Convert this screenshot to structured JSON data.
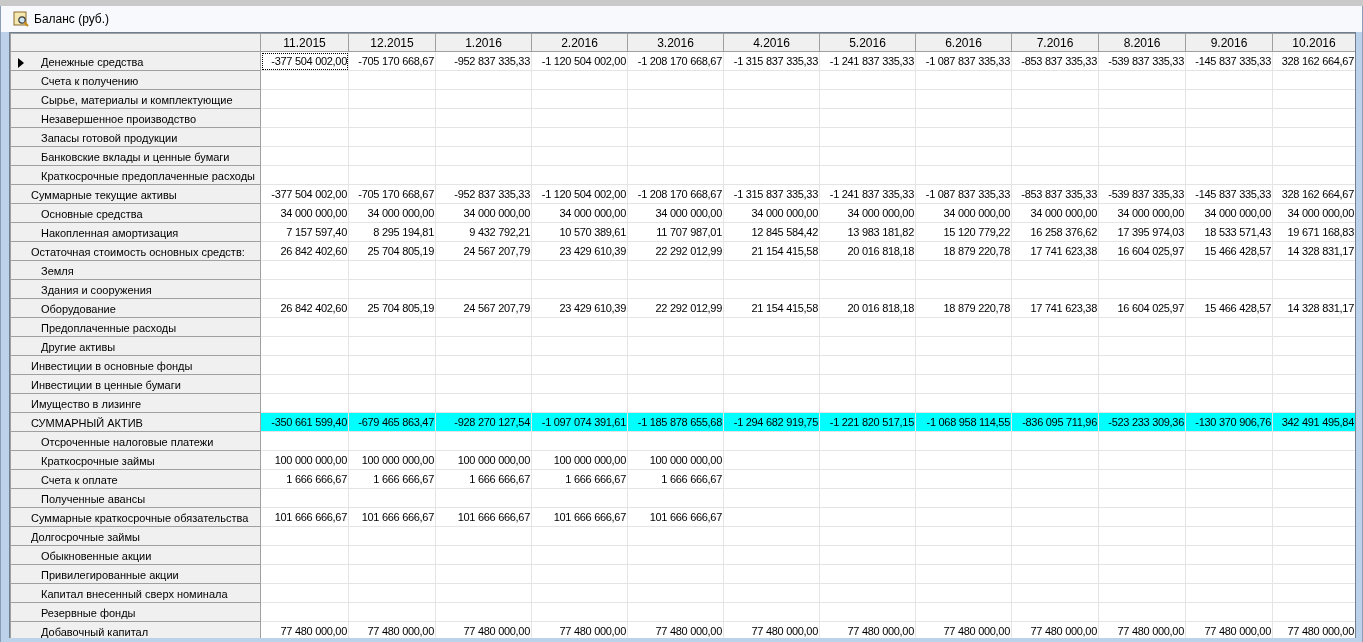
{
  "window": {
    "title": "Баланс (руб.)"
  },
  "table": {
    "columns": [
      "11.2015",
      "12.2015",
      "1.2016",
      "2.2016",
      "3.2016",
      "4.2016",
      "5.2016",
      "6.2016",
      "7.2016",
      "8.2016",
      "9.2016",
      "10.2016"
    ],
    "rows": [
      {
        "label": "Денежные средства",
        "kind": "detail",
        "current": true,
        "highlighted": false,
        "values": [
          "-377 504 002,00",
          "-705 170 668,67",
          "-952 837 335,33",
          "-1 120 504 002,00",
          "-1 208 170 668,67",
          "-1 315 837 335,33",
          "-1 241 837 335,33",
          "-1 087 837 335,33",
          "-853 837 335,33",
          "-539 837 335,33",
          "-145 837 335,33",
          "328 162 664,67"
        ]
      },
      {
        "label": "Счета к получению",
        "kind": "detail",
        "current": false,
        "highlighted": false
      },
      {
        "label": "Сырье, материалы и комплектующие",
        "kind": "detail",
        "current": false,
        "highlighted": false
      },
      {
        "label": "Незавершенное производство",
        "kind": "detail",
        "current": false,
        "highlighted": false
      },
      {
        "label": "Запасы готовой продукции",
        "kind": "detail",
        "current": false,
        "highlighted": false
      },
      {
        "label": "Банковские вклады и ценные бумаги",
        "kind": "detail",
        "current": false,
        "highlighted": false
      },
      {
        "label": "Краткосрочные предоплаченные расходы",
        "kind": "detail",
        "current": false,
        "highlighted": false
      },
      {
        "label": "Суммарные текущие активы",
        "kind": "total",
        "current": false,
        "highlighted": false,
        "values": [
          "-377 504 002,00",
          "-705 170 668,67",
          "-952 837 335,33",
          "-1 120 504 002,00",
          "-1 208 170 668,67",
          "-1 315 837 335,33",
          "-1 241 837 335,33",
          "-1 087 837 335,33",
          "-853 837 335,33",
          "-539 837 335,33",
          "-145 837 335,33",
          "328 162 664,67"
        ]
      },
      {
        "label": "Основные средства",
        "kind": "detail",
        "current": false,
        "highlighted": false,
        "values": [
          "34 000 000,00",
          "34 000 000,00",
          "34 000 000,00",
          "34 000 000,00",
          "34 000 000,00",
          "34 000 000,00",
          "34 000 000,00",
          "34 000 000,00",
          "34 000 000,00",
          "34 000 000,00",
          "34 000 000,00",
          "34 000 000,00"
        ]
      },
      {
        "label": "Накопленная амортизация",
        "kind": "detail",
        "current": false,
        "highlighted": false,
        "values": [
          "7 157 597,40",
          "8 295 194,81",
          "9 432 792,21",
          "10 570 389,61",
          "11 707 987,01",
          "12 845 584,42",
          "13 983 181,82",
          "15 120 779,22",
          "16 258 376,62",
          "17 395 974,03",
          "18 533 571,43",
          "19 671 168,83"
        ]
      },
      {
        "label": "Остаточная стоимость основных средств:",
        "kind": "total",
        "current": false,
        "highlighted": false,
        "values": [
          "26 842 402,60",
          "25 704 805,19",
          "24 567 207,79",
          "23 429 610,39",
          "22 292 012,99",
          "21 154 415,58",
          "20 016 818,18",
          "18 879 220,78",
          "17 741 623,38",
          "16 604 025,97",
          "15 466 428,57",
          "14 328 831,17"
        ]
      },
      {
        "label": "Земля",
        "kind": "detail",
        "current": false,
        "highlighted": false
      },
      {
        "label": "Здания и сооружения",
        "kind": "detail",
        "current": false,
        "highlighted": false
      },
      {
        "label": "Оборудование",
        "kind": "detail",
        "current": false,
        "highlighted": false,
        "values": [
          "26 842 402,60",
          "25 704 805,19",
          "24 567 207,79",
          "23 429 610,39",
          "22 292 012,99",
          "21 154 415,58",
          "20 016 818,18",
          "18 879 220,78",
          "17 741 623,38",
          "16 604 025,97",
          "15 466 428,57",
          "14 328 831,17"
        ]
      },
      {
        "label": "Предоплаченные расходы",
        "kind": "detail",
        "current": false,
        "highlighted": false
      },
      {
        "label": "Другие активы",
        "kind": "detail",
        "current": false,
        "highlighted": false
      },
      {
        "label": "Инвестиции в основные фонды",
        "kind": "total",
        "current": false,
        "highlighted": false
      },
      {
        "label": "Инвестиции в ценные бумаги",
        "kind": "total",
        "current": false,
        "highlighted": false
      },
      {
        "label": "Имущество в лизинге",
        "kind": "total",
        "current": false,
        "highlighted": false
      },
      {
        "label": "СУММАРНЫЙ АКТИВ",
        "kind": "total",
        "current": false,
        "highlighted": true,
        "values": [
          "-350 661 599,40",
          "-679 465 863,47",
          "-928 270 127,54",
          "-1 097 074 391,61",
          "-1 185 878 655,68",
          "-1 294 682 919,75",
          "-1 221 820 517,15",
          "-1 068 958 114,55",
          "-836 095 711,96",
          "-523 233 309,36",
          "-130 370 906,76",
          "342 491 495,84"
        ]
      },
      {
        "label": "Отсроченные налоговые платежи",
        "kind": "detail",
        "current": false,
        "highlighted": false
      },
      {
        "label": "Краткосрочные займы",
        "kind": "detail",
        "current": false,
        "highlighted": false,
        "values": [
          "100 000 000,00",
          "100 000 000,00",
          "100 000 000,00",
          "100 000 000,00",
          "100 000 000,00"
        ]
      },
      {
        "label": "Счета к оплате",
        "kind": "detail",
        "current": false,
        "highlighted": false,
        "values": [
          "1 666 666,67",
          "1 666 666,67",
          "1 666 666,67",
          "1 666 666,67",
          "1 666 666,67"
        ]
      },
      {
        "label": "Полученные авансы",
        "kind": "detail",
        "current": false,
        "highlighted": false
      },
      {
        "label": "Суммарные краткосрочные обязательства",
        "kind": "total",
        "current": false,
        "highlighted": false,
        "values": [
          "101 666 666,67",
          "101 666 666,67",
          "101 666 666,67",
          "101 666 666,67",
          "101 666 666,67"
        ]
      },
      {
        "label": "Долгосрочные займы",
        "kind": "total",
        "current": false,
        "highlighted": false
      },
      {
        "label": "Обыкновенные акции",
        "kind": "detail",
        "current": false,
        "highlighted": false
      },
      {
        "label": "Привилегированные акции",
        "kind": "detail",
        "current": false,
        "highlighted": false
      },
      {
        "label": "Капитал внесенный сверх номинала",
        "kind": "detail",
        "current": false,
        "highlighted": false
      },
      {
        "label": "Резервные фонды",
        "kind": "detail",
        "current": false,
        "highlighted": false
      },
      {
        "label": "Добавочный капитал",
        "kind": "detail",
        "current": false,
        "highlighted": false,
        "values": [
          "77 480 000,00",
          "77 480 000,00",
          "77 480 000,00",
          "77 480 000,00",
          "77 480 000,00",
          "77 480 000,00",
          "77 480 000,00",
          "77 480 000,00",
          "77 480 000,00",
          "77 480 000,00",
          "77 480 000,00",
          "77 480 000,00"
        ]
      }
    ]
  }
}
